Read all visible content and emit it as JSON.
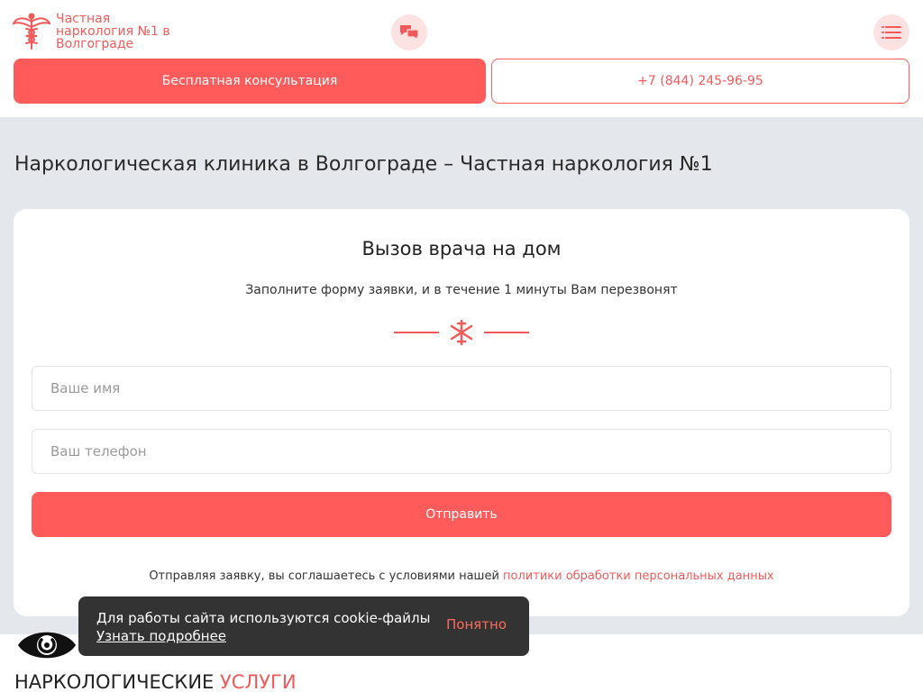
{
  "header": {
    "logo_text": "Частная наркология №1 в Волгограде",
    "consult_label": "Бесплатная консультация",
    "phone_label": "+7 (844) 245-96-95"
  },
  "page_title": "Наркологическая клиника в Волгограде – Частная наркология №1",
  "form": {
    "title": "Вызов врача на дом",
    "subtitle": "Заполните форму заявки, и в течение 1 минуты Вам перезвонят",
    "name_placeholder": "Ваше имя",
    "phone_placeholder": "Ваш телефон",
    "submit_label": "Отправить",
    "agree_text": "Отправляя заявку, вы соглашаетесь с условиями нашей",
    "agree_link": "политики обработки персональных данных"
  },
  "cookie": {
    "text": "Для работы сайта используются cookie-файлы",
    "more": "Узнать подробнее",
    "ok": "Понятно"
  },
  "services": {
    "title_main": "НАРКОЛОГИЧЕСКИЕ",
    "title_accent": "УСЛУГИ"
  },
  "colors": {
    "accent": "#ff5b5b",
    "background_grey": "#e4e7ec",
    "cookie_bg": "#333333"
  },
  "icons": [
    "caduceus-logo-icon",
    "chat-icon",
    "menu-icon",
    "medical-star-icon",
    "eye-icon"
  ]
}
